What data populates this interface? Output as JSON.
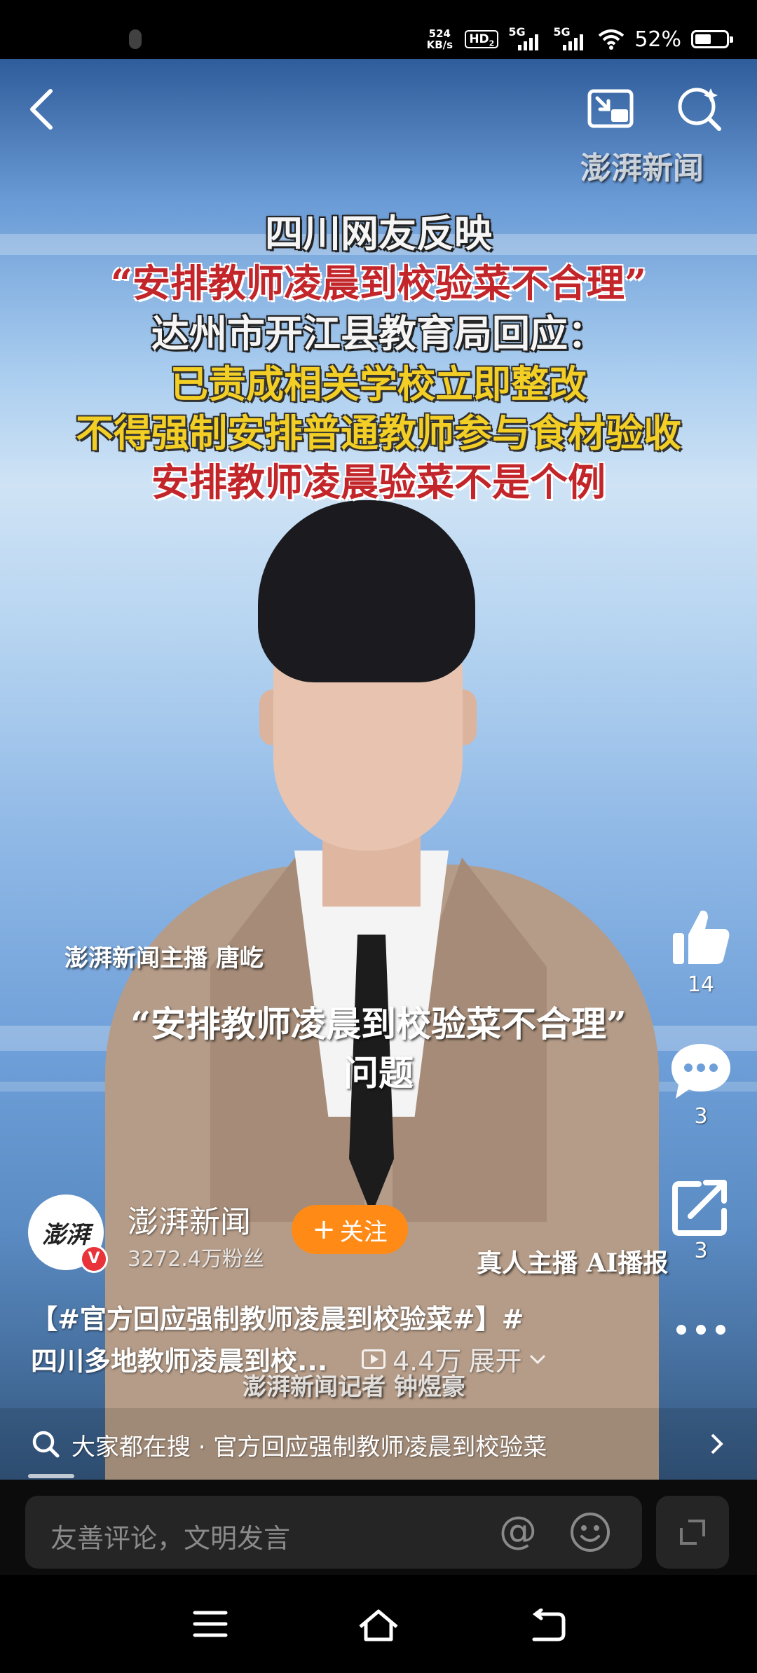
{
  "status_bar": {
    "net_speed_value": "524",
    "net_speed_unit": "KB/s",
    "hd_label": "HD",
    "hd_sub": "2",
    "sim1_label": "5G",
    "sim2_label": "5G",
    "battery_percent": "52%",
    "battery_level": 0.52
  },
  "top_bar": {
    "back_icon": "back-arrow-icon",
    "pip_icon": "picture-in-picture-icon",
    "search_icon": "search-icon"
  },
  "video": {
    "watermark": "澎湃新闻",
    "headline_lines": [
      "四川网友反映",
      "“安排教师凌晨到校验菜不合理”",
      "达州市开江县教育局回应：",
      "已责成相关学校立即整改",
      "不得强制安排普通教师参与食材验收",
      "安排教师凌晨验菜不是个例"
    ],
    "anchor_caption": "澎湃新闻主播  唐屹",
    "subtitle_line1": "“安排教师凌晨到校验菜不合理”",
    "subtitle_line2": "问题",
    "ai_label": "真人主播  AI播报",
    "reporter_caption": "澎湃新闻记者  钟煜豪"
  },
  "actions": {
    "like_count": "14",
    "comment_count": "3",
    "share_count": "3",
    "like_icon": "thumbs-up-icon",
    "comment_icon": "comment-bubble-icon",
    "share_icon": "share-icon",
    "more_icon": "more-dots-icon"
  },
  "author": {
    "avatar_text": "澎湃",
    "verified": "V",
    "name": "澎湃新闻",
    "fans": "3272.4万粉丝",
    "follow_label": "关注",
    "follow_plus": "+"
  },
  "description": {
    "line1": "【#官方回应强制教师凌晨到校验菜#】#",
    "line2": "四川多地教师凌晨到校...",
    "views": "4.4万",
    "expand_label": "展开"
  },
  "search_strip": {
    "text": "大家都在搜 · 官方回应强制教师凌晨到校验菜"
  },
  "comment_bar": {
    "placeholder": "友善评论，文明发言",
    "at_symbol": "@"
  },
  "colors": {
    "follow_orange": "#ff8a16",
    "verified_red": "#e8333a",
    "headline_red": "#c3262a",
    "headline_yellow": "#f3cf25"
  }
}
